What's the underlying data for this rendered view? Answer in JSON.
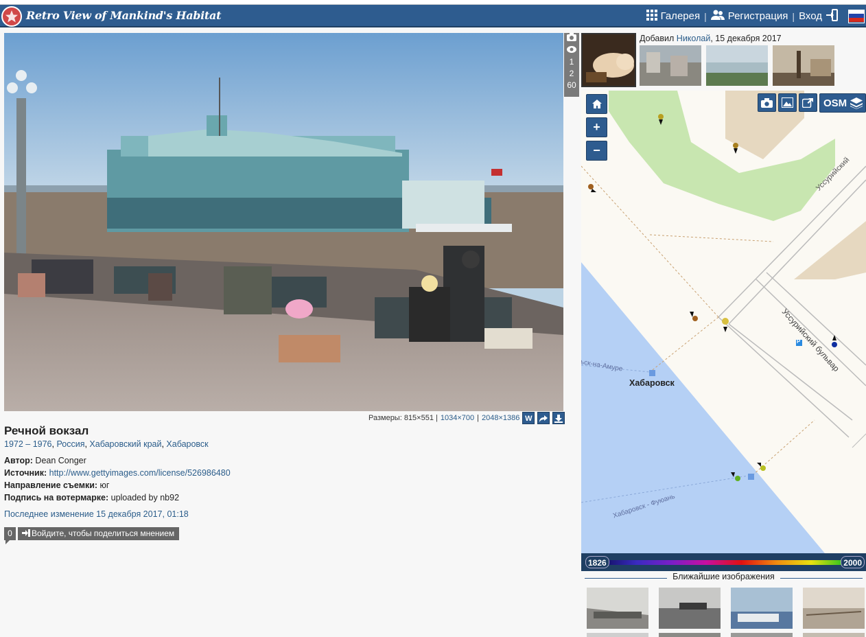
{
  "header": {
    "site_title": "Retro View of Mankind's Habitat",
    "nav": {
      "gallery": "Галерея",
      "register": "Регистрация",
      "login": "Вход"
    }
  },
  "photo": {
    "stats": {
      "views_icon": "eye-icon",
      "v1": "1",
      "v2": "2",
      "v3": "60"
    },
    "sizes_label": "Размеры: 815×551 |",
    "size_links": [
      "1034×700",
      "2048×1386"
    ],
    "size_sep": "|",
    "size_buttons": [
      "W"
    ],
    "title": "Речной вокзал",
    "years": "1972 – 1976",
    "location": [
      "Россия",
      "Хабаровский край",
      "Хабаровск"
    ],
    "author_label": "Автор:",
    "author": "Dean Conger",
    "source_label": "Источник:",
    "source": "http://www.gettyimages.com/license/526986480",
    "direction_label": "Направление съемки:",
    "direction": "юг",
    "watermark_label": "Подпись на вотермарке:",
    "watermark": "uploaded by nb92",
    "last_modified": "Последнее изменение 15 декабря 2017, 01:18",
    "comments_count": "0",
    "comments_login": "Войдите, чтобы поделиться мнением"
  },
  "uploader": {
    "added_prefix": "Добавил",
    "user": "Николай",
    "date": ", 15 декабря 2017"
  },
  "map": {
    "zoom_in": "+",
    "zoom_out": "−",
    "layer": "OSM",
    "labels": {
      "street1": "Уссурийский",
      "street2": "Уссурийский бульвар",
      "city": "Хабаровск",
      "river_route": "ьск-на-Амуре",
      "ferry": "Хабаровск - Фуюань",
      "parking": "P"
    },
    "year_min": "1826",
    "year_max": "2000"
  },
  "nearby": {
    "title": "Ближайшие изображения"
  },
  "colors": {
    "header": "#2e5c8f",
    "link": "#2a5c8a",
    "water": "#b5d0f5",
    "park": "#c8e6b0"
  }
}
